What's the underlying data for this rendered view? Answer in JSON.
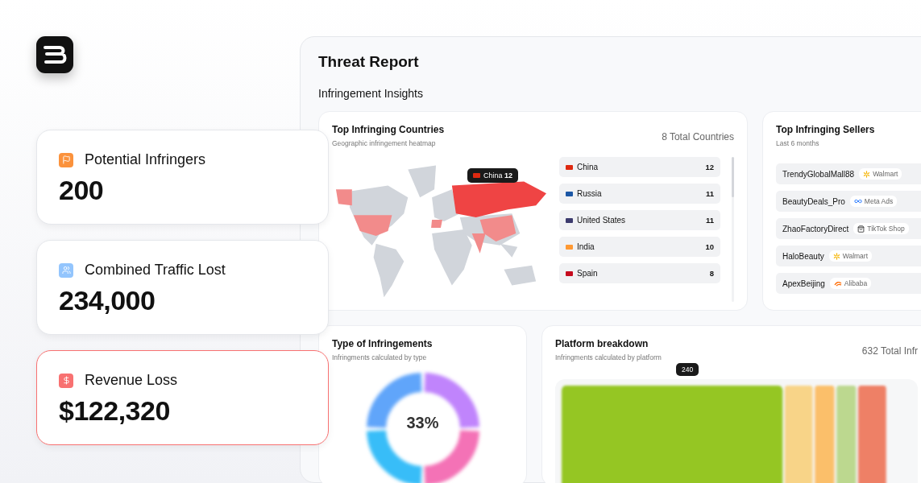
{
  "stats": [
    {
      "label": "Potential Infringers",
      "value": "200",
      "kind": "flag",
      "color": "#fb923c",
      "highlighted": false
    },
    {
      "label": "Combined Traffic Lost",
      "value": "234,000",
      "kind": "users",
      "color": "#93c5fd",
      "highlighted": false
    },
    {
      "label": "Revenue Loss",
      "value": "$122,320",
      "kind": "dollar",
      "color": "#f87171",
      "highlighted": true
    }
  ],
  "report": {
    "title": "Threat Report",
    "section": "Infringement Insights",
    "countries_card": {
      "title": "Top Infringing Countries",
      "subtitle": "Geographic infringement heatmap",
      "total": "8 Total Countries",
      "tooltip": {
        "text": "China **12**",
        "color": "#de2910"
      },
      "countries": [
        {
          "name": "China",
          "count": "12",
          "color": "#de2910",
          "faded": false
        },
        {
          "name": "Russia",
          "count": "11",
          "color": "#1c57a5",
          "faded": false
        },
        {
          "name": "United States",
          "count": "11",
          "color": "#3c3b6e",
          "faded": false
        },
        {
          "name": "India",
          "count": "10",
          "color": "#ff9933",
          "faded": false
        },
        {
          "name": "Spain",
          "count": "8",
          "color": "#c60b1e",
          "faded": false
        }
      ]
    },
    "sellers_card": {
      "title": "Top Infringing Sellers",
      "subtitle": "Last 6 months",
      "sellers": [
        {
          "name": "TrendyGlobalMall88",
          "platform": {
            "kind": "walmart",
            "label": "Walmart"
          },
          "faded": false
        },
        {
          "name": "BeautyDeals_Pro",
          "platform": {
            "kind": "meta",
            "label": "Meta Ads"
          },
          "faded": false
        },
        {
          "name": "ZhaoFactoryDirect",
          "platform": {
            "kind": "tiktok",
            "label": "TikTok Shop"
          },
          "faded": false
        },
        {
          "name": "HaloBeauty",
          "platform": {
            "kind": "walmart",
            "label": "Walmart"
          },
          "faded": false
        },
        {
          "name": "ApexBeijing",
          "platform": {
            "kind": "alibaba",
            "label": "Alibaba"
          },
          "faded": false
        }
      ]
    },
    "types_card": {
      "title": "Type of Infringements",
      "subtitle": "Infringments calculated by type",
      "center_label": "33%"
    },
    "platform_card": {
      "title": "Platform breakdown",
      "subtitle": "Infringments calculated by platform",
      "total": "632 Total Infr",
      "tooltip": "240"
    }
  }
}
